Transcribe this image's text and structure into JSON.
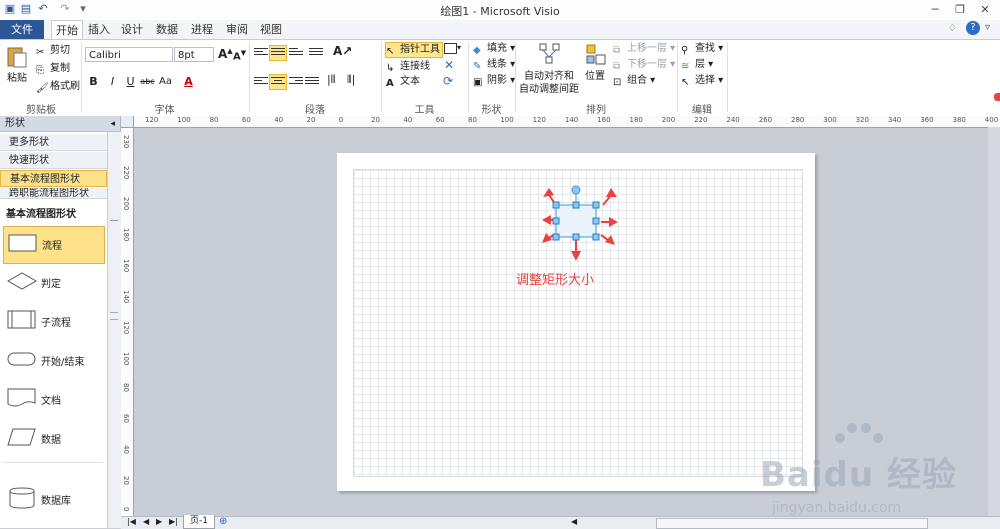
{
  "window": {
    "title": "绘图1 - Microsoft Visio"
  },
  "tabs": [
    "文件",
    "开始",
    "插入",
    "设计",
    "数据",
    "进程",
    "审阅",
    "视图"
  ],
  "ribbon": {
    "clipboard": {
      "paste": "粘贴",
      "cut": "剪切",
      "copy": "复制",
      "format_painter": "格式刷",
      "group_label": "剪贴板"
    },
    "font": {
      "font_name": "Calibri",
      "font_size": "8pt",
      "bold": "B",
      "italic": "I",
      "underline": "U",
      "strike": "abc",
      "case": "Aa",
      "color": "A",
      "group_label": "字体"
    },
    "paragraph": {
      "group_label": "段落"
    },
    "tools": {
      "pointer": "指针工具",
      "connector": "连接线",
      "text": "文本",
      "group_label": "工具"
    },
    "shape": {
      "fill": "填充",
      "line": "线条",
      "shadow": "阴影",
      "group_label": "形状"
    },
    "arrange": {
      "auto_align": "自动对齐和",
      "auto_space": "自动调整间距",
      "position": "位置",
      "bring_forward": "上移一层",
      "send_backward": "下移一层",
      "group": "组合",
      "group_label": "排列"
    },
    "editing": {
      "find": "查找",
      "layers": "层",
      "select": "选择",
      "group_label": "编辑"
    }
  },
  "shapes_panel": {
    "header": "形状",
    "stencils": [
      "更多形状",
      "快速形状",
      "基本流程图形状",
      "跨职能流程图形状"
    ],
    "active_stencil_title": "基本流程图形状",
    "shapes": [
      "流程",
      "判定",
      "子流程",
      "开始/结束",
      "文档",
      "数据",
      "数据库"
    ]
  },
  "hruler_labels": [
    "120",
    "100",
    "80",
    "60",
    "40",
    "20",
    "0",
    "20",
    "40",
    "60",
    "80",
    "100",
    "120",
    "140",
    "160",
    "180",
    "200",
    "220",
    "240",
    "260",
    "280",
    "300",
    "320",
    "340",
    "360",
    "380",
    "400"
  ],
  "vruler_labels": [
    "230",
    "220",
    "200",
    "180",
    "160",
    "140",
    "120",
    "100",
    "80",
    "60",
    "40",
    "20",
    "0"
  ],
  "annotation": "调整矩形大小",
  "status": {
    "page_tab": "页-1"
  },
  "watermark": {
    "main": "Baidu 经验",
    "sub": "jingyan.baidu.com"
  },
  "colors": {
    "file_tab": "#2b5797",
    "highlight": "#fde68b",
    "annotation": "#e8433f",
    "handles": "#3b9bd8"
  }
}
